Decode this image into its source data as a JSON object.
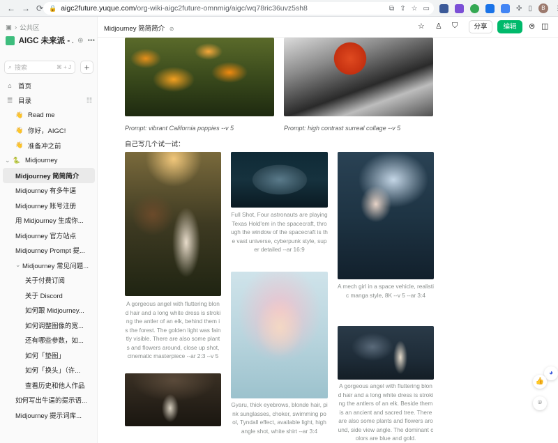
{
  "browser": {
    "host": "aigc2future.yuque.com",
    "path": "/org-wiki-aigc2future-omnmig/aigc/wq78ric36uvz5sh8",
    "avatar_letter": "B"
  },
  "sidebar": {
    "breadcrumb": "公共区",
    "book_title": "AIGC 未来派 - ...",
    "search_placeholder": "搜索",
    "search_shortcut": "⌘ + J",
    "items": [
      {
        "label": "首页",
        "icon": "home-icon",
        "indent": 0
      },
      {
        "label": "目录",
        "icon": "toc-icon",
        "indent": 0
      },
      {
        "label": "Read me",
        "icon": "👋",
        "indent": 1
      },
      {
        "label": "你好，AIGC!",
        "icon": "👋",
        "indent": 1
      },
      {
        "label": "准备冲之前",
        "icon": "👋",
        "indent": 1
      },
      {
        "label": "Midjourney",
        "icon": "🐍",
        "indent": 0,
        "expanded": true
      },
      {
        "label": "Midjourney 简简简介",
        "indent": 1,
        "active": true
      },
      {
        "label": "Midjourney 有多牛逼",
        "indent": 1
      },
      {
        "label": "Midjourney 账号注册",
        "indent": 1
      },
      {
        "label": "用 Midjourney 生成你...",
        "indent": 1
      },
      {
        "label": "Midjourney 官方站点",
        "indent": 1
      },
      {
        "label": "Midjourney Prompt 提...",
        "indent": 1
      },
      {
        "label": "Midjourney 常见问题...",
        "indent": 1,
        "expanded": true
      },
      {
        "label": "关于付费订阅",
        "indent": 2
      },
      {
        "label": "关于 Discord",
        "indent": 2
      },
      {
        "label": "如何跟 Midjourney...",
        "indent": 2
      },
      {
        "label": "如何调整图像的宽...",
        "indent": 2
      },
      {
        "label": "还有哪些参数，如...",
        "indent": 2
      },
      {
        "label": "如何「垫图」",
        "indent": 2
      },
      {
        "label": "如何「换头」（许...",
        "indent": 2
      },
      {
        "label": "查看历史和他人作品",
        "indent": 2
      },
      {
        "label": "如何写出牛逼的提示语...",
        "indent": 1
      },
      {
        "label": "Midjourney 提示词库...",
        "indent": 1
      }
    ]
  },
  "header": {
    "doc_title": "Midjourney 简简简介",
    "share_label": "分享",
    "edit_label": "编辑"
  },
  "content": {
    "caption_left": "Prompt: vibrant California poppies --v 5",
    "caption_right": "Prompt: high contrast surreal collage --v 5",
    "heading": "自己写几个试一试：",
    "prompt_angel": "A gorgeous angel with fluttering blond hair and a long white dress is stroking the antler of an elk, behind them is the forest. The golden light was faintly visible. There are also some plants and flowers around, close up shot, cinematic masterpiece --ar 2:3 --v 5",
    "prompt_astronauts": "Full Shot, Four astronauts are playing Texas Hold'em in the spacecraft, through the window of the spacecraft is the vast universe, cyberpunk style, super detailed --ar 16:9",
    "prompt_mech": "A mech girl in a space vehicle, realistic manga style, 8K --v 5 --ar 3:4",
    "prompt_gyaru": "Gyaru, thick eyebrows, blonde hair, pink sunglasses, choker, swimming pool, Tyndall effect, available light, high angle shot, white shirt --ar 3:4",
    "prompt_angel2": "A gorgeous angel with fluttering blond hair and a long white dress is stroking the antlers of an elk. Beside them is an ancient and sacred tree. There are also some plants and flowers around, side view angle. The dominant colors are blue and gold."
  }
}
